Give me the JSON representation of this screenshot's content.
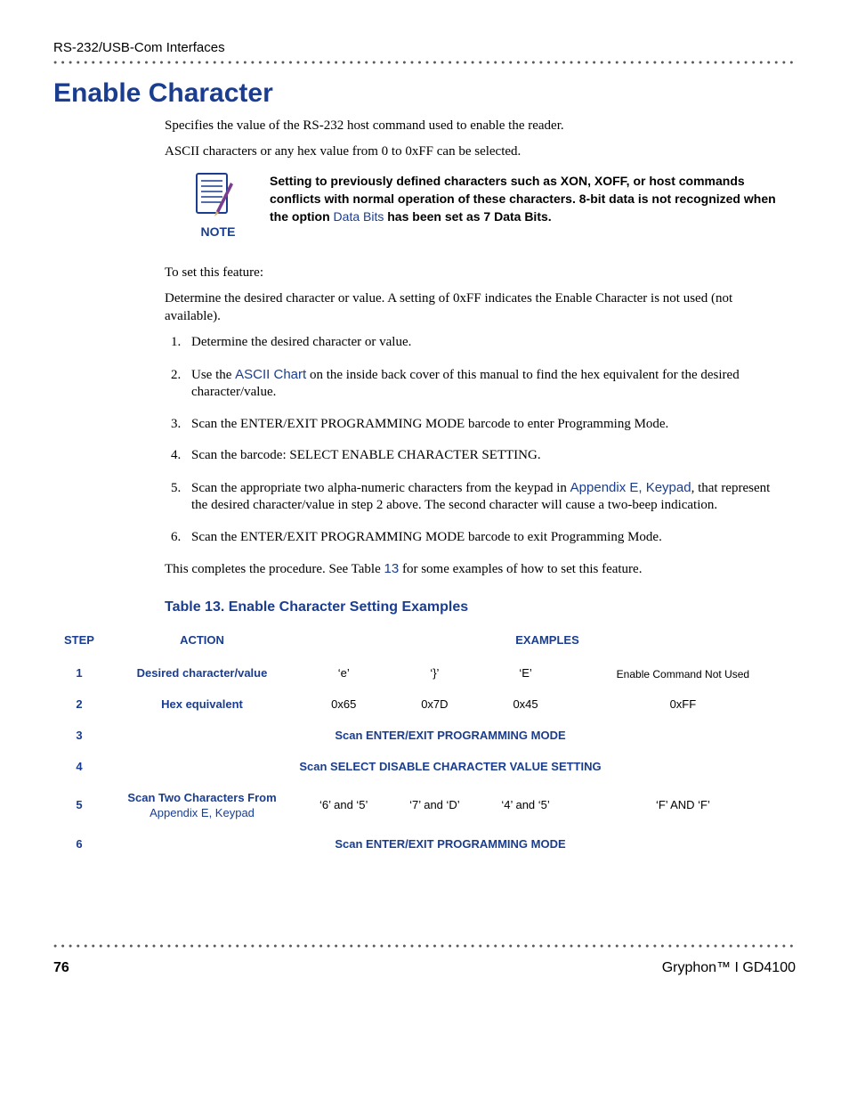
{
  "header": "RS-232/USB-Com Interfaces",
  "title": "Enable Character",
  "intro1": "Specifies the value of the RS-232 host command used to enable the reader.",
  "intro2": "ASCII characters or any hex value from 0 to 0xFF can be selected.",
  "note_label": "NOTE",
  "note_text_1": "Setting to previously defined characters such as XON, XOFF, or host commands conflicts with normal operation of these characters. 8-bit data is not recognized when the option ",
  "note_link": "Data Bits",
  "note_text_2": " has been set as 7 Data Bits.",
  "to_set": "To set this feature:",
  "determine": "Determine the desired character or value. A setting of 0xFF indicates the Enable Character is not used (not available).",
  "steps": {
    "s1": "Determine the desired character or value.",
    "s2a": "Use the ",
    "s2_link": "ASCII Chart",
    "s2b": " on the inside back cover of this manual to find the hex equivalent for the desired character/value.",
    "s3": "Scan the ENTER/EXIT PROGRAMMING MODE barcode to enter Programming Mode.",
    "s4": "Scan the barcode: SELECT ENABLE CHARACTER SETTING.",
    "s5a": "Scan the appropriate two alpha-numeric characters from the keypad in ",
    "s5_link": "Appendix E, Keypad",
    "s5b": ", that represent the desired character/value in step 2 above. The second character will cause a two-beep indication.",
    "s6": "Scan the ENTER/EXIT PROGRAMMING MODE barcode to exit Programming Mode."
  },
  "closing_a": "This completes the procedure. See Table ",
  "closing_link": "13",
  "closing_b": " for some examples of how to set this feature.",
  "table_title": "Table 13. Enable Character Setting Examples",
  "table": {
    "headers": {
      "step": "Step",
      "action": "Action",
      "examples": "Examples"
    },
    "rows": {
      "r1": {
        "num": "1",
        "action": "Desired character/value",
        "c1": "‘e’",
        "c2": "‘}’",
        "c3": "‘E’",
        "c4": "Enable Command Not Used"
      },
      "r2": {
        "num": "2",
        "action": "Hex equivalent",
        "c1": "0x65",
        "c2": "0x7D",
        "c3": "0x45",
        "c4": "0xFF"
      },
      "r3": {
        "num": "3",
        "full": "Scan ENTER/EXIT PROGRAMMING MODE"
      },
      "r4": {
        "num": "4",
        "full": "Scan SELECT DISABLE CHARACTER VALUE SETTING"
      },
      "r5": {
        "num": "5",
        "action_a": "Scan Two Characters From ",
        "action_link": "Appendix E, Keypad",
        "c1": "‘6’ and ‘5’",
        "c2": "‘7’ and ‘D’",
        "c3": "‘4’ and ‘5’",
        "c4": "‘F’ AND ‘F’"
      },
      "r6": {
        "num": "6",
        "full": "Scan ENTER/EXIT PROGRAMMING MODE"
      }
    }
  },
  "footer": {
    "page": "76",
    "product": "Gryphon™ I GD4100"
  },
  "dots": "●●●●●●●●●●●●●●●●●●●●●●●●●●●●●●●●●●●●●●●●●●●●●●●●●●●●●●●●●●●●●●●●●●●●●●●●●●●●●●●●●●●●●●●●●●●●●●●●●●●●●●●●●●●●●●●●●●●●●●●●●●●●●●●●●●●●●●●●●●●●●●●●●●●●●●●●●●"
}
